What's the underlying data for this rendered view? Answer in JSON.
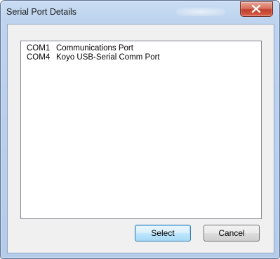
{
  "window": {
    "title": "Serial Port Details"
  },
  "ports": [
    {
      "port": "COM1",
      "description": "Communications Port"
    },
    {
      "port": "COM4",
      "description": "Koyo USB-Serial Comm Port"
    }
  ],
  "buttons": {
    "select_label": "Select",
    "cancel_label": "Cancel"
  },
  "icons": {
    "close": "close-icon"
  }
}
